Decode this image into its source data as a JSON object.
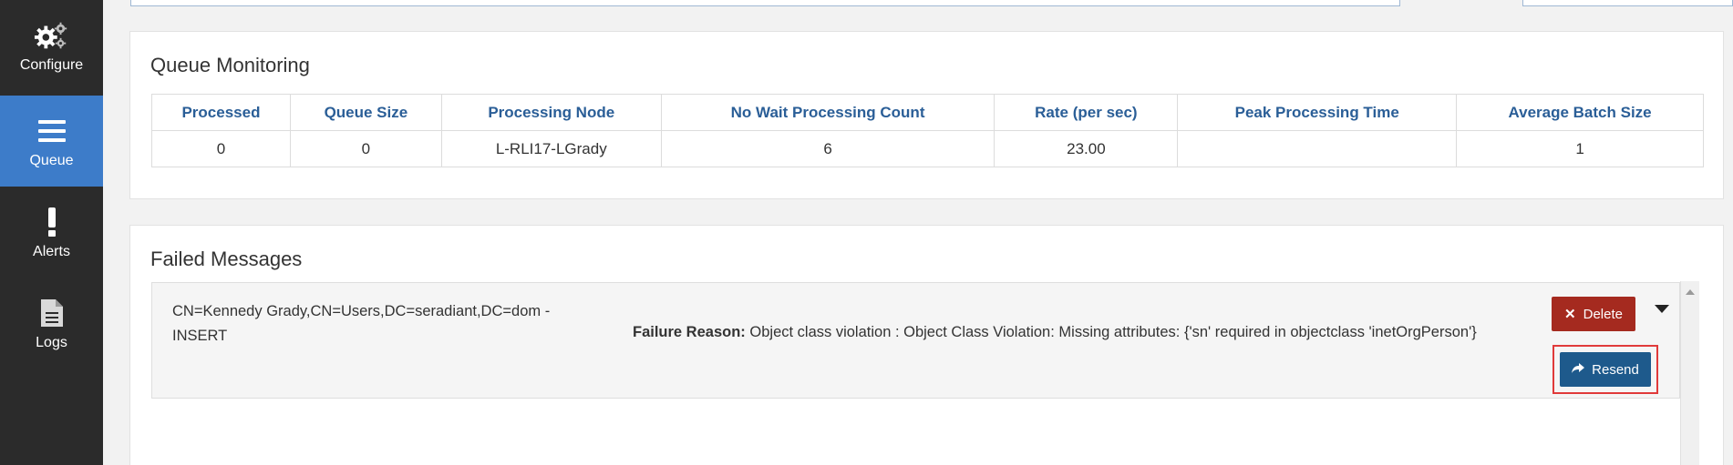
{
  "sidebar": {
    "items": [
      {
        "label": "Configure",
        "icon": "gears-icon",
        "active": false
      },
      {
        "label": "Queue",
        "icon": "hamburger-icon",
        "active": true
      },
      {
        "label": "Alerts",
        "icon": "exclamation-icon",
        "active": false
      },
      {
        "label": "Logs",
        "icon": "document-icon",
        "active": false
      }
    ]
  },
  "queue_monitoring": {
    "title": "Queue Monitoring",
    "columns": [
      "Processed",
      "Queue Size",
      "Processing Node",
      "No Wait Processing Count",
      "Rate (per sec)",
      "Peak Processing Time",
      "Average Batch Size"
    ],
    "rows": [
      [
        "0",
        "0",
        "L-RLI17-LGrady",
        "6",
        "23.00",
        "",
        "1"
      ]
    ]
  },
  "failed_messages": {
    "title": "Failed Messages",
    "items": [
      {
        "dn": "CN=Kennedy Grady,CN=Users,DC=seradiant,DC=dom - INSERT",
        "failure_label": "Failure Reason:",
        "failure_text": "Object class violation : Object Class Violation: Missing attributes: {'sn' required in objectclass 'inetOrgPerson'}",
        "delete_label": "Delete",
        "resend_label": "Resend"
      }
    ]
  },
  "colors": {
    "sidebar_bg": "#2b2b2b",
    "active_nav": "#3d7cc9",
    "header_text": "#2a5e97",
    "delete_btn": "#a52a1f",
    "resend_btn": "#1e5a8c",
    "highlight": "#e03a3a"
  }
}
